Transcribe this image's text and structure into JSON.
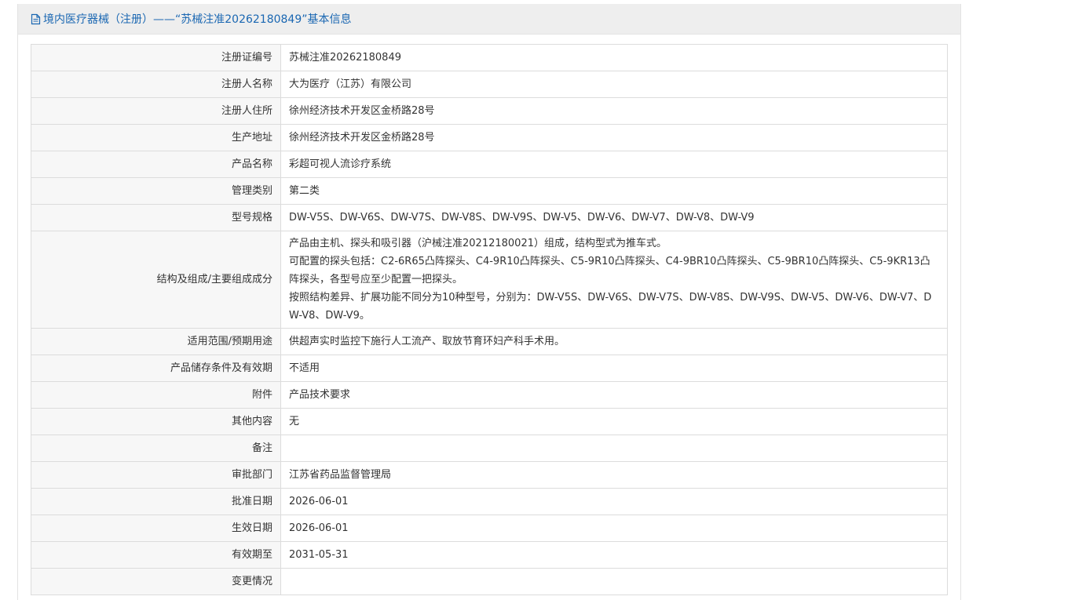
{
  "header": {
    "title": "境内医疗器械（注册）——“苏械注准20262180849”基本信息",
    "accent_color": "#1a67b2",
    "icon": "document-icon"
  },
  "rows": [
    {
      "label": "注册证编号",
      "value": "苏械注准20262180849"
    },
    {
      "label": "注册人名称",
      "value": "大为医疗（江苏）有限公司"
    },
    {
      "label": "注册人住所",
      "value": "徐州经济技术开发区金桥路28号"
    },
    {
      "label": "生产地址",
      "value": "徐州经济技术开发区金桥路28号"
    },
    {
      "label": "产品名称",
      "value": "彩超可视人流诊疗系统"
    },
    {
      "label": "管理类别",
      "value": "第二类"
    },
    {
      "label": "型号规格",
      "value": "DW-V5S、DW-V6S、DW-V7S、DW-V8S、DW-V9S、DW-V5、DW-V6、DW-V7、DW-V8、DW-V9"
    },
    {
      "label": "结构及组成/主要组成成分",
      "lines": [
        "产品由主机、探头和吸引器（沪械注准20212180021）组成，结构型式为推车式。",
        "可配置的探头包括：C2-6R65凸阵探头、C4-9R10凸阵探头、C5-9R10凸阵探头、C4-9BR10凸阵探头、C5-9BR10凸阵探头、C5-9KR13凸阵探头，各型号应至少配置一把探头。",
        "按照结构差异、扩展功能不同分为10种型号，分别为：DW-V5S、DW-V6S、DW-V7S、DW-V8S、DW-V9S、DW-V5、DW-V6、DW-V7、DW-V8、DW-V9。"
      ]
    },
    {
      "label": "适用范围/预期用途",
      "value": "供超声实时监控下施行人工流产、取放节育环妇产科手术用。"
    },
    {
      "label": "产品储存条件及有效期",
      "value": "不适用"
    },
    {
      "label": "附件",
      "value": "产品技术要求"
    },
    {
      "label": "其他内容",
      "value": "无"
    },
    {
      "label": "备注",
      "value": ""
    },
    {
      "label": "审批部门",
      "value": "江苏省药品监督管理局"
    },
    {
      "label": "批准日期",
      "value": "2026-06-01"
    },
    {
      "label": "生效日期",
      "value": "2026-06-01"
    },
    {
      "label": "有效期至",
      "value": "2031-05-31"
    },
    {
      "label": "变更情况",
      "value": ""
    }
  ]
}
